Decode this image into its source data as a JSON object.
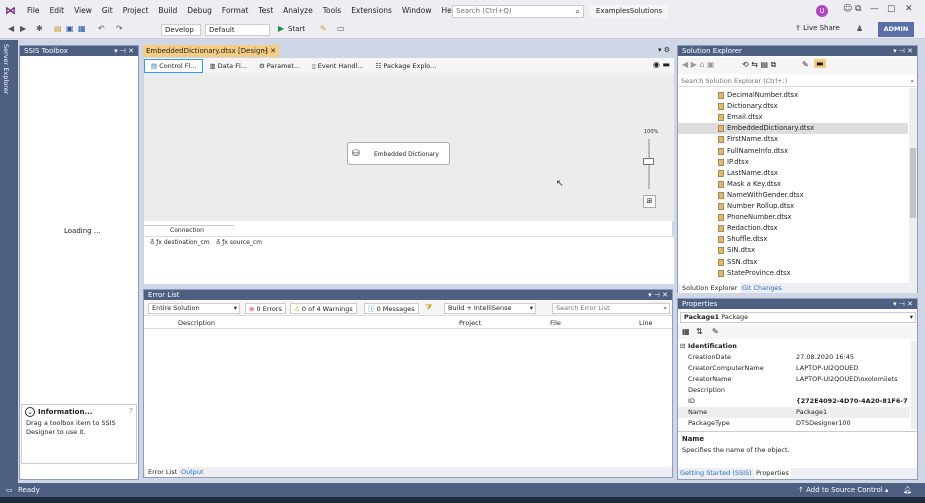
{
  "menu": [
    "File",
    "Edit",
    "View",
    "Git",
    "Project",
    "Build",
    "Debug",
    "Format",
    "Test",
    "Analyze",
    "Tools",
    "Extensions",
    "Window",
    "Help"
  ],
  "search": {
    "placeholder": "Search (Ctrl+Q)"
  },
  "solution_title": "ExamplesSolutions",
  "user_initial": "U",
  "toolbar": {
    "config": "Develop",
    "platform": "Default",
    "start": "Start",
    "live_share": "Live Share",
    "admin": "ADMIN"
  },
  "left_strip": "Server Explorer",
  "toolbox": {
    "title": "SSIS Toolbox",
    "loading": "Loading ...",
    "info_title": "Information...",
    "info_text": "Drag a toolbox item to SSIS Designer to use it."
  },
  "designer": {
    "doc_tab": "EmbeddedDictionary.dtsx [Design]",
    "tabs": [
      "Control Fl...",
      "Data Fl...",
      "Paramet...",
      "Event Handl...",
      "Package Explo..."
    ],
    "task_label": "Embedded Dictionary",
    "zoom": "100%",
    "connection_managers_tab": "Connection Managers",
    "connections": [
      "destination_cm",
      "source_cm"
    ]
  },
  "error_list": {
    "title": "Error List",
    "scope": "Entire Solution",
    "errors": "0 Errors",
    "warnings": "0 of 4 Warnings",
    "messages": "0 Messages",
    "build_filter": "Build + IntelliSense",
    "search_placeholder": "Search Error List",
    "columns": [
      "Description",
      "Project",
      "File",
      "Line"
    ],
    "bottom_tabs": [
      "Error List",
      "Output"
    ]
  },
  "solution_explorer": {
    "title": "Solution Explorer",
    "search_placeholder": "Search Solution Explorer (Ctrl+;)",
    "files": [
      "DecimalNumber.dtsx",
      "Dictionary.dtsx",
      "Email.dtsx",
      "EmbeddedDictionary.dtsx",
      "FirstName.dtsx",
      "FullNameInfo.dtsx",
      "IP.dtsx",
      "LastName.dtsx",
      "Mask a Key.dtsx",
      "NameWithGender.dtsx",
      "Number Rollup.dtsx",
      "PhoneNumber.dtsx",
      "Redaction.dtsx",
      "Shuffle.dtsx",
      "SIN.dtsx",
      "SSN.dtsx",
      "StateProvince.dtsx"
    ],
    "selected_index": 3,
    "bottom_tabs": [
      "Solution Explorer",
      "Git Changes"
    ]
  },
  "properties": {
    "title": "Properties",
    "object": "Package1",
    "object_type": "Package",
    "section": "Identification",
    "rows": [
      {
        "k": "CreationDate",
        "v": "27.08.2020 16:45"
      },
      {
        "k": "CreatorComputerName",
        "v": "LAPTOP-UI2QOUED"
      },
      {
        "k": "CreatorName",
        "v": "LAPTOP-UI2QOUED\\oxolomiiets"
      },
      {
        "k": "Description",
        "v": ""
      },
      {
        "k": "ID",
        "v": "{272E4092-4D70-4A20-81F6-74F"
      },
      {
        "k": "Name",
        "v": "Package1"
      },
      {
        "k": "PackageType",
        "v": "DTSDesigner100"
      }
    ],
    "desc_title": "Name",
    "desc_text": "Specifies the name of the object.",
    "bottom_tabs": [
      "Getting Started (SSIS)",
      "Properties"
    ]
  },
  "status": {
    "ready": "Ready",
    "source_control": "Add to Source Control"
  },
  "colors": {
    "accent": "#4d6082",
    "tab_active": "#f5cc84",
    "vs_purple": "#68217a"
  }
}
